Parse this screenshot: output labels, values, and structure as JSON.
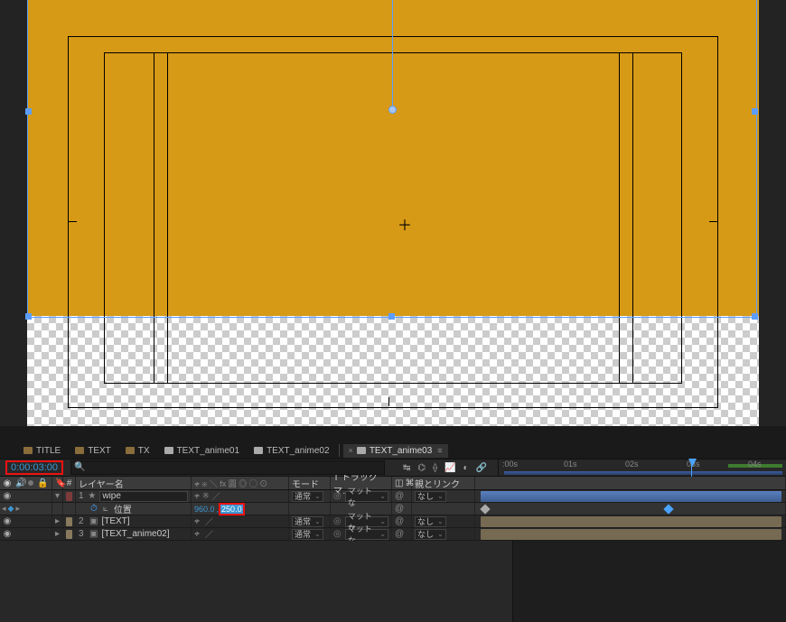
{
  "tabs": {
    "items": [
      {
        "label": "TITLE",
        "kind": "folder"
      },
      {
        "label": "TEXT",
        "kind": "folder"
      },
      {
        "label": "TX",
        "kind": "folder"
      },
      {
        "label": "TEXT_anime01",
        "kind": "comp"
      },
      {
        "label": "TEXT_anime02",
        "kind": "comp"
      },
      {
        "label": "TEXT_anime03",
        "kind": "comp"
      }
    ],
    "active_index": 5,
    "close_glyph": "×",
    "menu_glyph": "≡"
  },
  "timecode": "0:00:03:00",
  "search_placeholder": "",
  "ruler": {
    "labels": [
      ":00s",
      "01s",
      "02s",
      "03s",
      "04s"
    ],
    "cti_fraction": 0.73,
    "work_end_label": ""
  },
  "columns": {
    "eye": "◉",
    "speaker": "",
    "solo": "",
    "lock": "🔒",
    "tag": "🔖",
    "idx": "#",
    "name": "レイヤー名",
    "switches": "ቀ ※ ＼ fx 圓 ◎ ◯ ⊙",
    "mode": "モード",
    "track": "T  トラックマ…",
    "mat_icon": "◫",
    "parent": "親とリンク",
    "link_icon": "⌘"
  },
  "layers": [
    {
      "idx": "1",
      "name": "wipe",
      "color": "ct-red",
      "star": true,
      "mode": "通常",
      "track": "マットな",
      "parent": "なし",
      "twisty_open": true
    },
    {
      "idx": "2",
      "name": "[TEXT]",
      "color": "ct-tan",
      "star": false,
      "mode": "通常",
      "track": "マットな",
      "parent": "なし",
      "twisty_open": false
    },
    {
      "idx": "3",
      "name": "[TEXT_anime02]",
      "color": "ct-tan",
      "star": false,
      "mode": "通常",
      "track": "マットな",
      "parent": "なし",
      "twisty_open": false
    }
  ],
  "position_prop": {
    "stopwatch": "⏱",
    "label": "位置",
    "x": "960.0",
    "y": "250.0",
    "keyframes": [
      0.015,
      0.72
    ]
  },
  "glyphs": {
    "eye": "◉",
    "tri_closed": "▸",
    "tri_open": "▾",
    "star": "★",
    "comp": "▣",
    "link": "⧉",
    "at": "@",
    "diamond": "◆",
    "prev": "◂",
    "next": "▸",
    "search": "🔍",
    "snap": "↹",
    "graph": "📈",
    "shy": "⟠",
    "brain": "⌬",
    "clip": "🔗",
    "motionblur": "◐",
    "sw_base": "ቀ",
    "sw_slash": "／"
  }
}
